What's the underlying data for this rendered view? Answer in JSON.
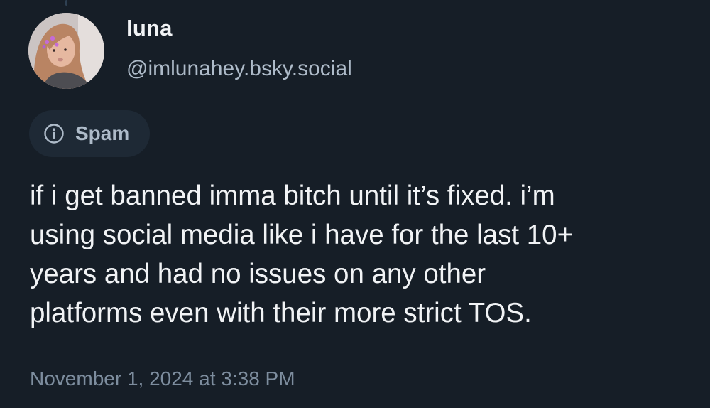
{
  "author": {
    "display_name": "luna",
    "handle": "@imlunahey.bsky.social",
    "avatar_icon": "profile-photo"
  },
  "label": {
    "icon": "info-circle-icon",
    "text": "Spam"
  },
  "post": {
    "lines": [
      "if i get banned imma bitch until it’s fixed. i’m",
      "using social media like i have for the last 10+",
      "years and had no issues on any other",
      "platforms even with their more strict TOS."
    ]
  },
  "timestamp": "November 1, 2024 at 3:38 PM",
  "colors": {
    "background": "#161e27",
    "primary_text": "#f1f3f5",
    "secondary_text": "#aebbc9",
    "muted_text": "#7d8d9e",
    "chip_background": "#1e2935"
  }
}
